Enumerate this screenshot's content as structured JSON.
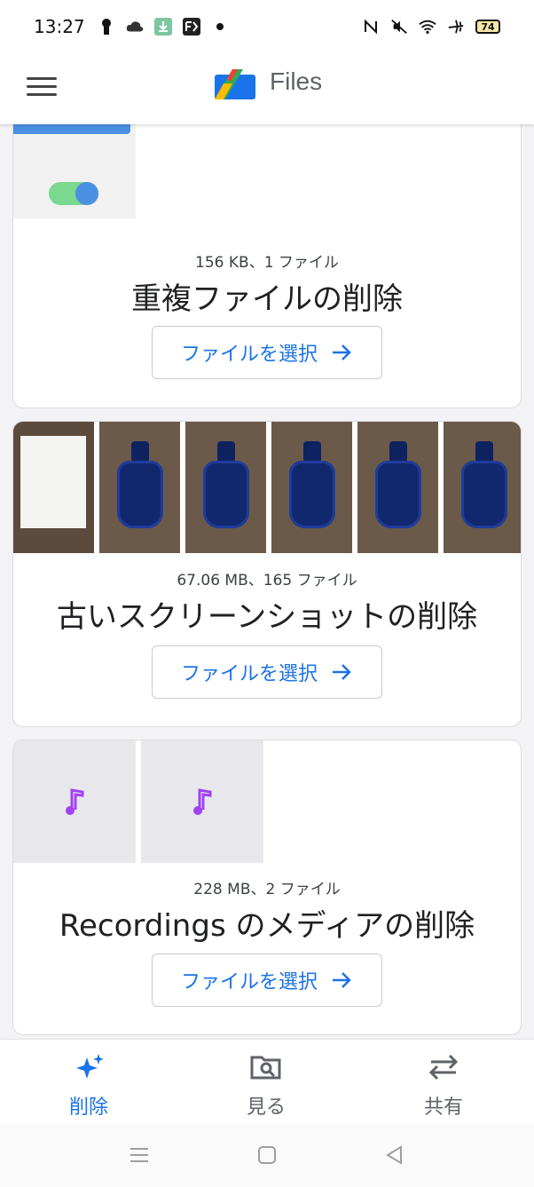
{
  "status_bar": {
    "time": "13:27",
    "battery": "74"
  },
  "app_bar": {
    "title": "Files"
  },
  "cards": [
    {
      "meta": "156 KB、1 ファイル",
      "title": "重複ファイルの削除",
      "button_label": "ファイルを選択"
    },
    {
      "meta": "67.06 MB、165 ファイル",
      "title": "古いスクリーンショットの削除",
      "button_label": "ファイルを選択"
    },
    {
      "meta": "228 MB、2 ファイル",
      "title": "Recordings のメディアの削除",
      "button_label": "ファイルを選択"
    }
  ],
  "bottom_nav": {
    "items": [
      {
        "label": "削除",
        "icon": "sparkle-icon",
        "active": true
      },
      {
        "label": "見る",
        "icon": "folder-search-icon",
        "active": false
      },
      {
        "label": "共有",
        "icon": "swap-arrows-icon",
        "active": false
      }
    ]
  },
  "colors": {
    "accent": "#1a73e8",
    "music_icon": "#a142f4"
  }
}
